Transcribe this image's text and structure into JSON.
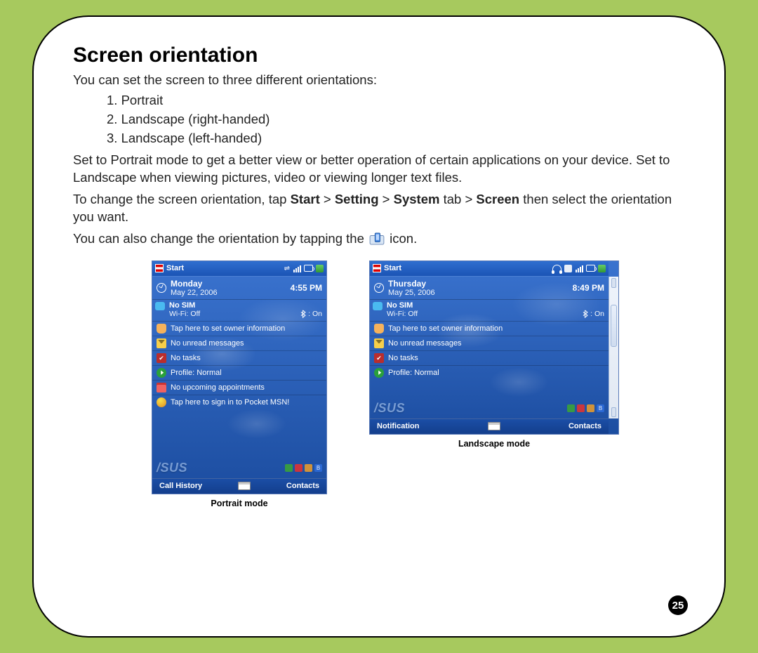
{
  "heading": "Screen orientation",
  "intro": "You can set the screen to three different orientations:",
  "orientations": [
    "Portrait",
    "Landscape (right-handed)",
    "Landscape (left-handed)"
  ],
  "para2": "Set to Portrait mode to get a better view or better operation of certain applications on your device. Set to Landscape when viewing pictures, video or viewing longer text files.",
  "para3_pre": "To change the screen orientation, tap ",
  "para3_path": [
    "Start",
    "Setting",
    "System",
    "Screen"
  ],
  "para3_mid_tab": " tab > ",
  "para3_post": " then select the orientation you want.",
  "para4_pre": "You can also change the orientation by tapping the ",
  "para4_post": " icon.",
  "page_number": "25",
  "captions": {
    "portrait": "Portrait mode",
    "landscape": "Landscape mode"
  },
  "portrait": {
    "start_label": "Start",
    "day": "Monday",
    "date": "May 22, 2006",
    "time": "4:55 PM",
    "no_sim": "No SIM",
    "wifi": "Wi-Fi: Off",
    "bt": ": On",
    "items": [
      "Tap here to set owner information",
      "No unread messages",
      "No tasks",
      "Profile: Normal",
      "No upcoming appointments",
      "Tap here to sign in to Pocket MSN!"
    ],
    "soft_left": "Call History",
    "soft_right": "Contacts"
  },
  "landscape": {
    "start_label": "Start",
    "day": "Thursday",
    "date": "May 25, 2006",
    "time": "8:49 PM",
    "no_sim": "No SIM",
    "wifi": "Wi-Fi: Off",
    "bt": ": On",
    "items": [
      "Tap here to set owner information",
      "No unread messages",
      "No tasks",
      "Profile: Normal"
    ],
    "soft_left": "Notification",
    "soft_right": "Contacts"
  }
}
